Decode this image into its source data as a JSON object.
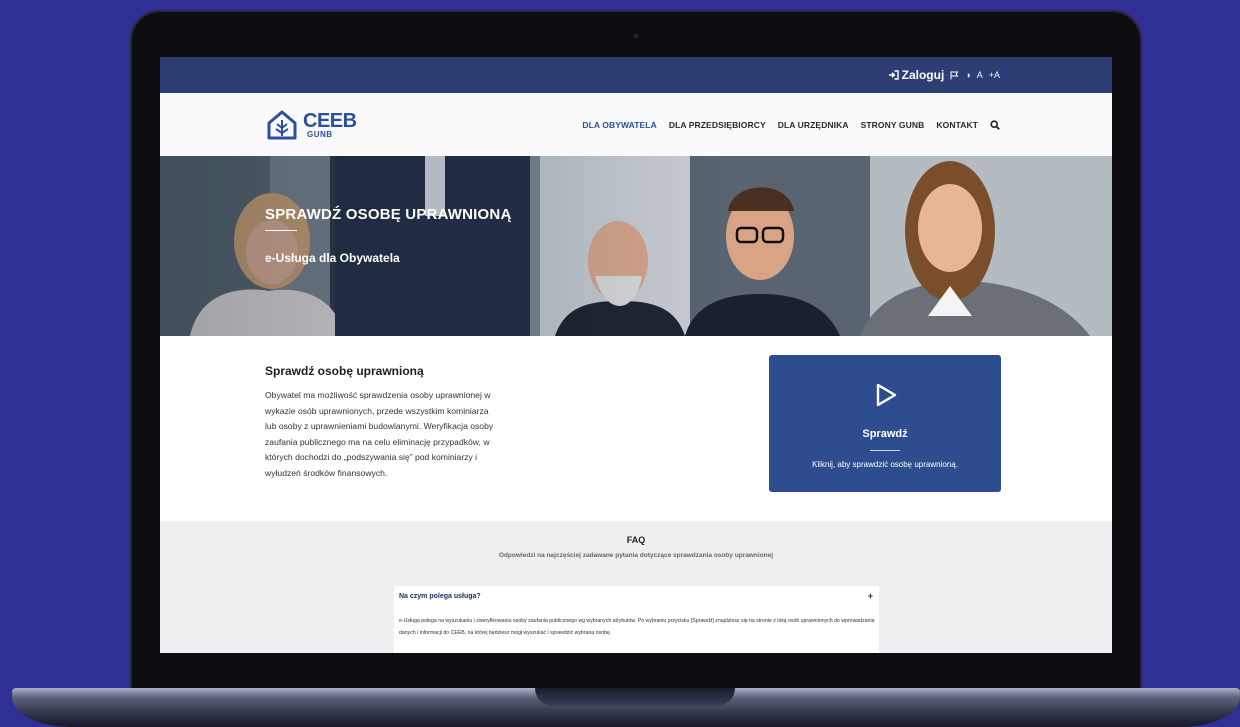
{
  "topbar": {
    "login_label": "Zaloguj",
    "contrast_label": "◑",
    "font_small": "A",
    "font_large": "+A"
  },
  "logo": {
    "main": "CEEB",
    "sub": "GUNB"
  },
  "nav": {
    "items": [
      "DLA OBYWATELA",
      "DLA PRZEDSIĘBIORCY",
      "DLA URZĘDNIKA",
      "STRONY GUNB",
      "KONTAKT"
    ],
    "active_index": 0
  },
  "hero": {
    "title": "SPRAWDŹ OSOBĘ UPRAWNIONĄ",
    "subtitle": "e-Usługa dla Obywatela"
  },
  "info": {
    "title": "Sprawdź osobę uprawnioną",
    "text": "Obywatel ma możliwość sprawdzenia osoby uprawnionej w wykazie osób uprawnionych, przede wszystkim kominiarza lub osoby z uprawnieniami budowlanymi. Weryfikacja osoby zaufania publicznego ma na celu eliminację przypadków, w których dochodzi do „podszywania się” pod kominiarzy i wyłudzeń środków finansowych."
  },
  "card": {
    "title": "Sprawdź",
    "description": "Kliknij, aby sprawdzić osobę uprawnioną."
  },
  "faq": {
    "title": "FAQ",
    "subtitle": "Odpowiedzi na najczęściej zadawane pytania dotyczące sprawdzania osoby uprawnionej",
    "items": [
      {
        "question": "Na czym polega usługa?",
        "toggle": "+",
        "answer": "e-Usługa polega na wyszukaniu i zweryfikowaniu osoby zaufania publicznego wg wybranych atrybutów. Po wybraniu przycisku [Sprawdź] znajdziesz się na stronie z listą osób uprawnionych do wprowadzania danych i informacji do CEEB, na której będziesz mógł wyszukać i sprawdzić wybraną osobę."
      }
    ]
  },
  "colors": {
    "background": "#2f2f94",
    "topbar": "#2d3e74",
    "brand": "#2d4f9e",
    "card": "#2d4d8f",
    "faq_bg": "#efeff1"
  },
  "icons": {
    "login": "sign-in-icon",
    "flag": "flag-icon",
    "contrast": "contrast-icon",
    "search": "search-icon",
    "play": "play-icon",
    "logo": "house-tree-icon"
  }
}
